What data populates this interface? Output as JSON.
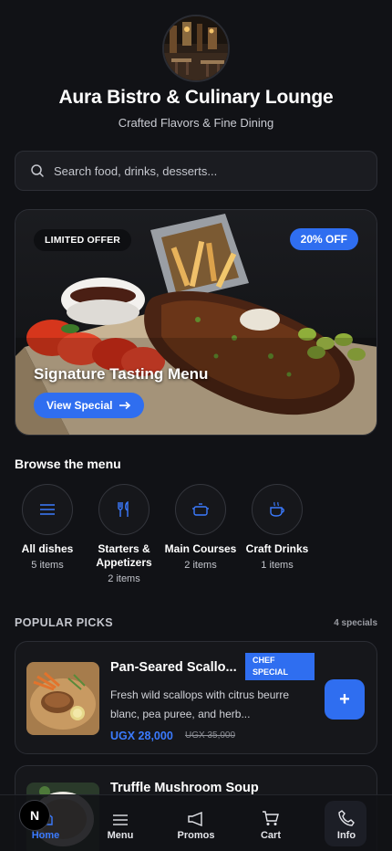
{
  "header": {
    "title": "Aura Bistro & Culinary Lounge",
    "subtitle": "Crafted Flavors & Fine Dining"
  },
  "search": {
    "placeholder": "Search food, drinks, desserts..."
  },
  "hero": {
    "badge_left": "LIMITED OFFER",
    "badge_right": "20% OFF",
    "title": "Signature Tasting Menu",
    "button_label": "View Special"
  },
  "browse": {
    "heading": "Browse the menu",
    "categories": [
      {
        "label": "All dishes",
        "count": "5 items",
        "icon": "list-icon"
      },
      {
        "label": "Starters & Appetizers",
        "count": "2 items",
        "icon": "fork-knife-icon"
      },
      {
        "label": "Main Courses",
        "count": "2 items",
        "icon": "pot-icon"
      },
      {
        "label": "Craft Drinks",
        "count": "1 items",
        "icon": "cup-icon"
      }
    ]
  },
  "popular": {
    "heading": "POPULAR PICKS",
    "count": "4 specials",
    "items": [
      {
        "title": "Pan-Seared Scallo...",
        "badge": "CHEF SPECIAL",
        "description": "Fresh wild scallops with citrus beurre blanc, pea puree, and herb...",
        "price": "UGX 28,000",
        "old_price": "UGX 35,000",
        "add_label": "+"
      },
      {
        "title": "Truffle Mushroom Soup"
      }
    ]
  },
  "nav": {
    "user_initial": "N",
    "items": [
      {
        "label": "Home",
        "icon": "home-icon",
        "active": true
      },
      {
        "label": "Menu",
        "icon": "menu-icon"
      },
      {
        "label": "Promos",
        "icon": "megaphone-icon"
      },
      {
        "label": "Cart",
        "icon": "cart-icon"
      },
      {
        "label": "Info",
        "icon": "phone-icon"
      }
    ]
  },
  "colors": {
    "background": "#111216",
    "accent": "#2f6ef0",
    "price": "#3b7bff",
    "card": "#16171b"
  }
}
